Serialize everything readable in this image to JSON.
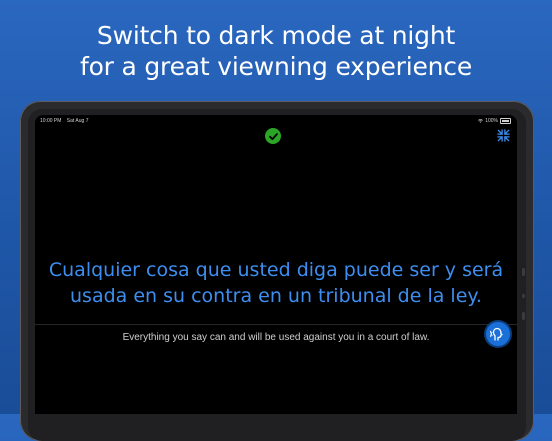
{
  "headline": {
    "line1": "Switch to dark mode at night",
    "line2": "for a great viewning experience"
  },
  "status_bar": {
    "time": "10:00 PM",
    "date": "Sat Aug 7",
    "battery": "100%"
  },
  "translation": {
    "spanish_line1": "Cualquier cosa que usted diga puede ser y será",
    "spanish_line2": "usada en su contra en un tribunal de la ley.",
    "english": "Everything you say can and will be used against you in a court of law."
  },
  "icons": {
    "status": "checkmark-circle-icon",
    "exit_fullscreen": "compress-arrows-icon",
    "listen": "speaking-head-icon"
  },
  "colors": {
    "background": "#2a67bf",
    "spanish_text": "#3d8ef0",
    "check": "#2aa526",
    "listen_button": "#1a6fd8"
  }
}
